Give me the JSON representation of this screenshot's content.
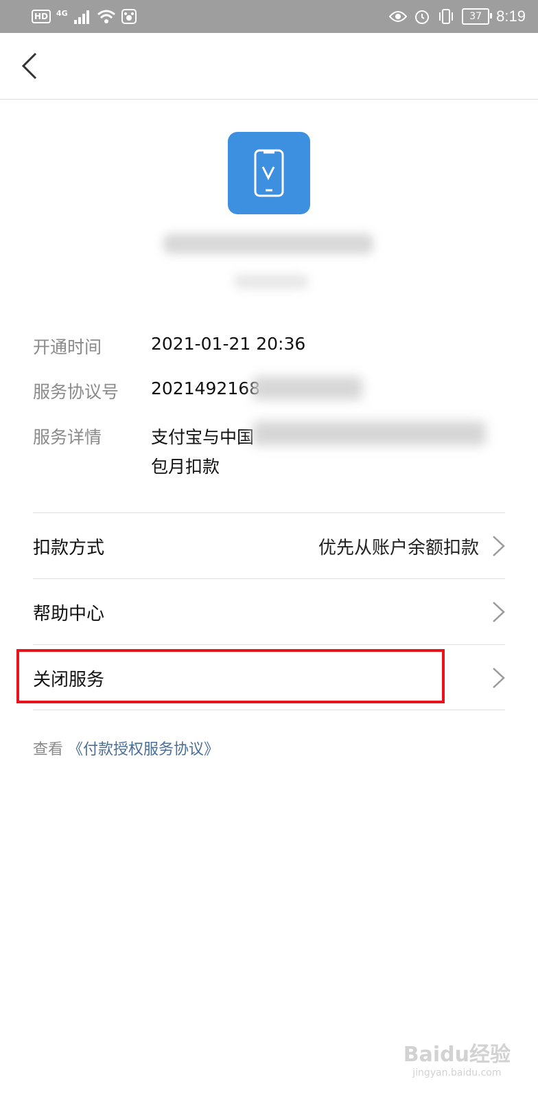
{
  "status_bar": {
    "hd": "HD",
    "network": "4G",
    "battery": "37",
    "time": "8:19",
    "icons": [
      "signal-icon",
      "wifi-icon",
      "app-notification-icon",
      "eye-icon",
      "alarm-icon",
      "vibrate-icon",
      "battery-icon"
    ]
  },
  "nav": {
    "back_icon": "chevron-left-icon"
  },
  "app": {
    "icon": "phone-v-icon",
    "accent": "#3d8fe0"
  },
  "details": [
    {
      "label": "开通时间",
      "value": "2021-01-21 20:36"
    },
    {
      "label": "服务协议号",
      "value": "20214921​68"
    },
    {
      "label": "服务详情",
      "value_line1": "支付宝与中国",
      "value_line2": "包月扣款"
    }
  ],
  "menu": [
    {
      "label": "扣款方式",
      "value": "优先从账户余额扣款"
    },
    {
      "label": "帮助中心",
      "value": ""
    },
    {
      "label": "关闭服务",
      "value": ""
    }
  ],
  "footer": {
    "prefix": "查看",
    "link": "《付款授权服务协议》"
  },
  "watermark": {
    "main": "Baidu经验",
    "sub": "jingyan.baidu.com"
  },
  "highlight_color": "#e8141b"
}
